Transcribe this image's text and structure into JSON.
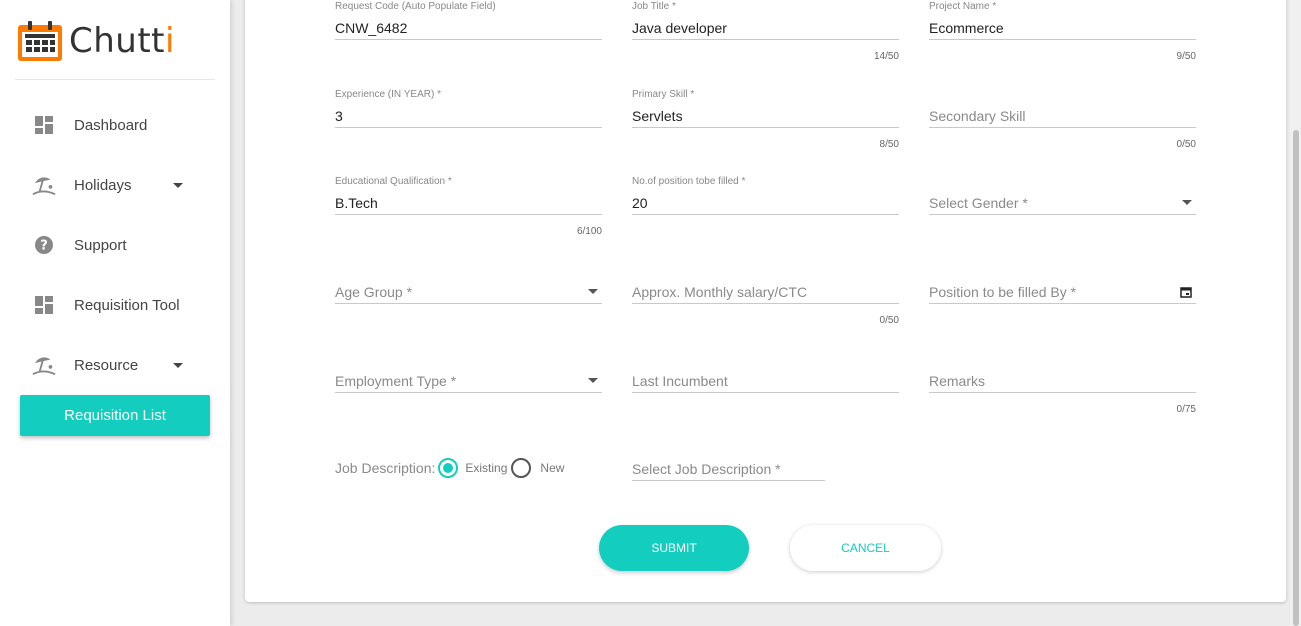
{
  "app": {
    "name_main": "Chutt",
    "name_accent": "i"
  },
  "sidebar": {
    "items": [
      {
        "label": "Dashboard",
        "icon": "dashboard-icon"
      },
      {
        "label": "Holidays",
        "icon": "beach-umbrella-icon",
        "has_dropdown": true
      },
      {
        "label": "Support",
        "icon": "help-circle-icon"
      },
      {
        "label": "Requisition Tool",
        "icon": "dashboard-icon"
      },
      {
        "label": "Resource",
        "icon": "beach-umbrella-icon",
        "has_dropdown": true
      }
    ],
    "active_subitem": "Requisition List"
  },
  "form": {
    "request_code": {
      "label": "Request Code (Auto Populate Field)",
      "value": "CNW_6482"
    },
    "job_title": {
      "label": "Job Title *",
      "value": "Java developer",
      "counter": "14/50"
    },
    "project_name": {
      "label": "Project Name *",
      "value": "Ecommerce",
      "counter": "9/50"
    },
    "experience": {
      "label": "Experience (IN YEAR) *",
      "value": "3"
    },
    "primary_skill": {
      "label": "Primary Skill *",
      "value": "Servlets",
      "counter": "8/50"
    },
    "secondary_skill": {
      "placeholder": "Secondary Skill",
      "counter": "0/50"
    },
    "education": {
      "label": "Educational Qualification *",
      "value": "B.Tech",
      "counter": "6/100"
    },
    "positions": {
      "label": "No.of position tobe filled *",
      "value": "20"
    },
    "gender": {
      "placeholder": "Select Gender *"
    },
    "age_group": {
      "placeholder": "Age Group *"
    },
    "salary": {
      "placeholder": "Approx. Monthly salary/CTC",
      "counter": "0/50"
    },
    "filled_by": {
      "placeholder": "Position to be filled By *"
    },
    "employment_type": {
      "placeholder": "Employment Type *"
    },
    "last_incumbent": {
      "placeholder": "Last Incumbent"
    },
    "remarks": {
      "placeholder": "Remarks",
      "counter": "0/75"
    },
    "job_description": {
      "label": "Job Description:",
      "options": [
        "Existing",
        "New"
      ],
      "selected": "Existing",
      "select_placeholder": "Select Job Description *"
    }
  },
  "buttons": {
    "submit": "SUBMIT",
    "cancel": "CANCEL"
  },
  "colors": {
    "accent": "#13cdbe",
    "logo_orange": "#ff7a00"
  }
}
